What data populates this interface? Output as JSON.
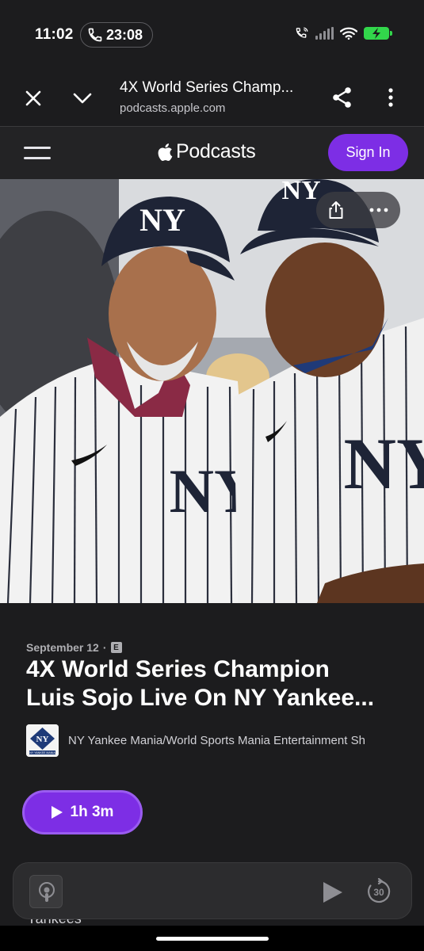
{
  "status_bar": {
    "time": "11:02",
    "call_duration": "23:08",
    "battery_color": "#32d74b"
  },
  "browser": {
    "page_title": "4X World Series Champ...",
    "url": "podcasts.apple.com",
    "icons": [
      "close-icon",
      "chevron-down-icon",
      "share-icon",
      "more-vertical-icon"
    ]
  },
  "podcasts_header": {
    "brand": "Podcasts",
    "sign_in_label": "Sign In",
    "accent_color": "#7d2ee5"
  },
  "episode": {
    "date": "September 12",
    "separator": "·",
    "explicit_badge": "E",
    "title_line1": "4X World Series Champion",
    "title_line2": "Luis Sojo Live On NY Yankee...",
    "show_name": "NY Yankee Mania/World Sports Mania Entertainment Sh",
    "show_art_caption": "NY YANKEE MANIA",
    "play_duration": "1h 3m"
  },
  "mini_player": {
    "skip_seconds": "30",
    "peek_text": "Yankees"
  }
}
